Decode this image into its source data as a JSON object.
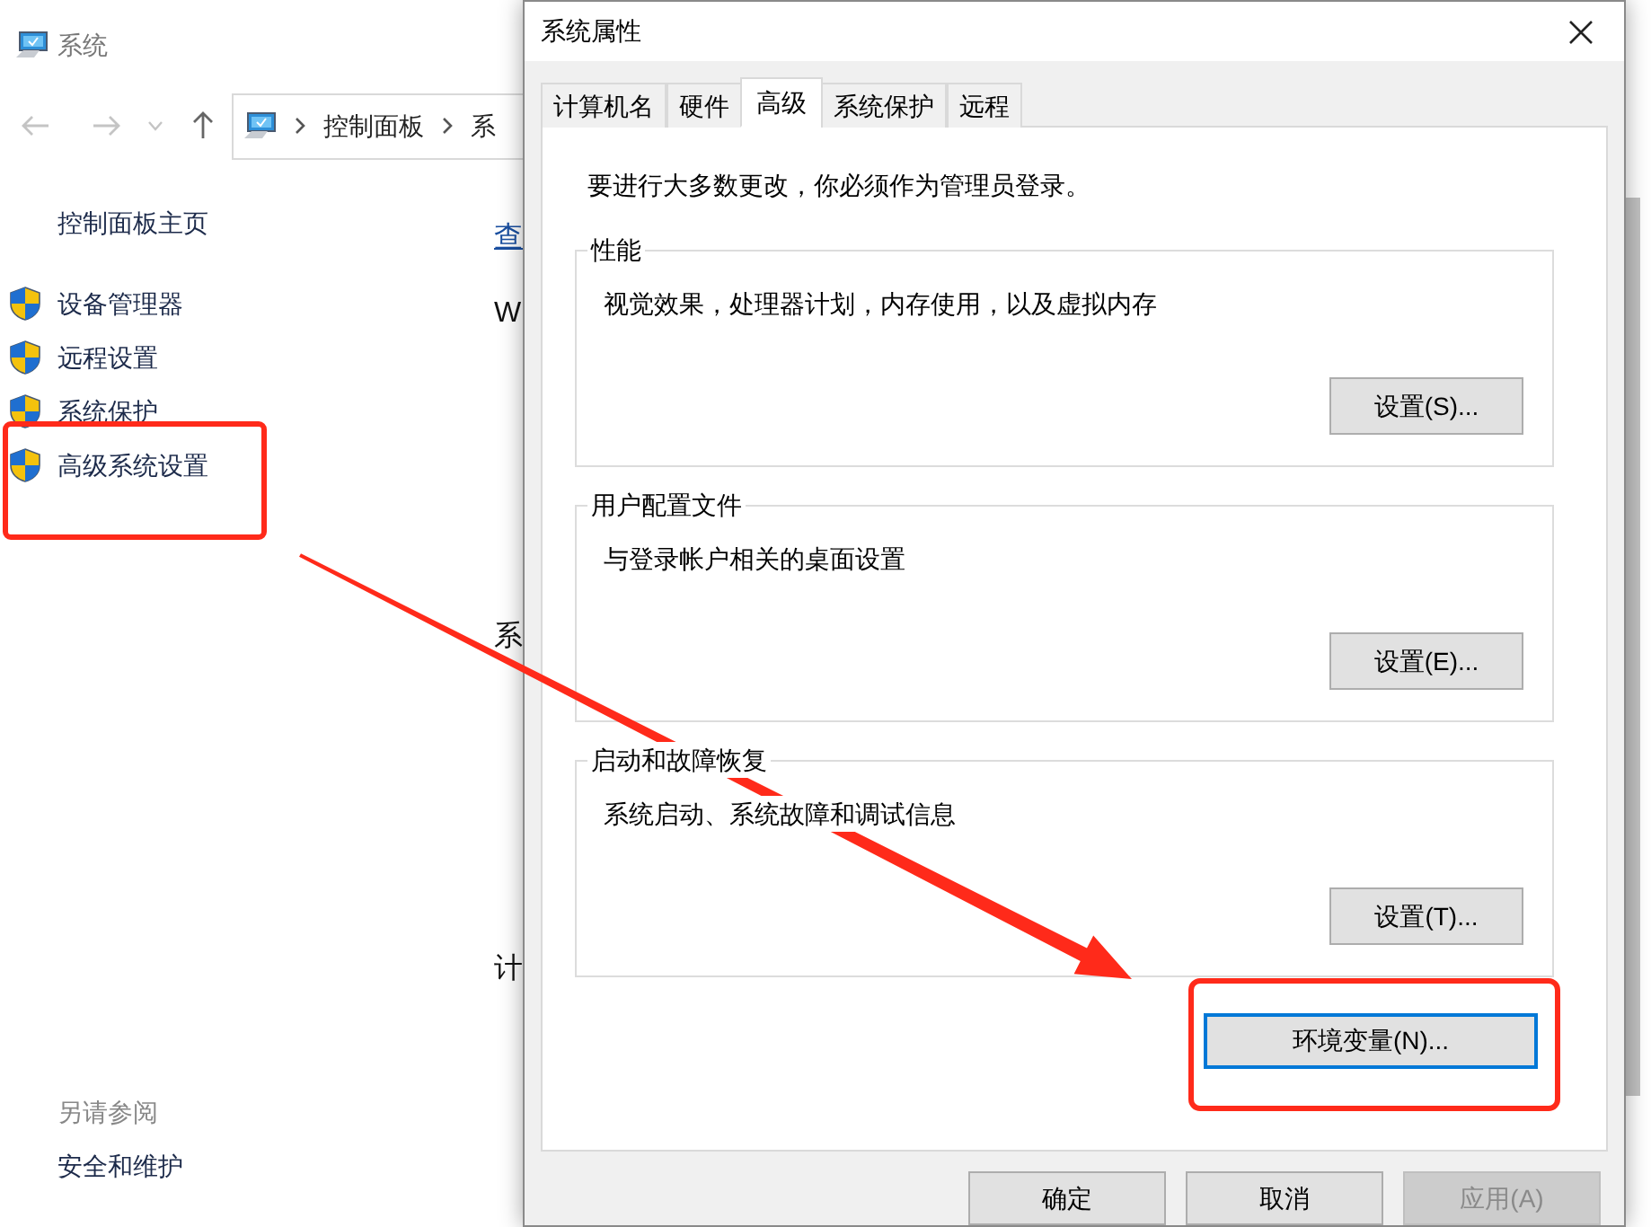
{
  "background_window": {
    "title": "系统",
    "breadcrumb": [
      "控制面板",
      "系"
    ],
    "sidebar": {
      "home": "控制面板主页",
      "items": [
        {
          "label": "设备管理器"
        },
        {
          "label": "远程设置"
        },
        {
          "label": "系统保护"
        },
        {
          "label": "高级系统设置"
        }
      ],
      "see_also_title": "另请参阅",
      "see_also": [
        "安全和维护"
      ]
    },
    "content_fragments": [
      {
        "text": "查",
        "kind": "link"
      },
      {
        "text": "W",
        "kind": "text"
      },
      {
        "text": "系",
        "kind": "text"
      },
      {
        "text": "计",
        "kind": "text"
      }
    ]
  },
  "dialog": {
    "title": "系统属性",
    "tabs": [
      {
        "label": "计算机名",
        "selected": false
      },
      {
        "label": "硬件",
        "selected": false
      },
      {
        "label": "高级",
        "selected": true
      },
      {
        "label": "系统保护",
        "selected": false
      },
      {
        "label": "远程",
        "selected": false
      }
    ],
    "admin_note": "要进行大多数更改，你必须作为管理员登录。",
    "groups": [
      {
        "title": "性能",
        "description": "视觉效果，处理器计划，内存使用，以及虚拟内存",
        "button": "设置(S)..."
      },
      {
        "title": "用户配置文件",
        "description": "与登录帐户相关的桌面设置",
        "button": "设置(E)..."
      },
      {
        "title": "启动和故障恢复",
        "description": "系统启动、系统故障和调试信息",
        "button": "设置(T)..."
      }
    ],
    "env_button": "环境变量(N)...",
    "footer_buttons": [
      {
        "label": "确定",
        "disabled": false
      },
      {
        "label": "取消",
        "disabled": false
      },
      {
        "label": "应用(A)",
        "disabled": true
      }
    ]
  }
}
